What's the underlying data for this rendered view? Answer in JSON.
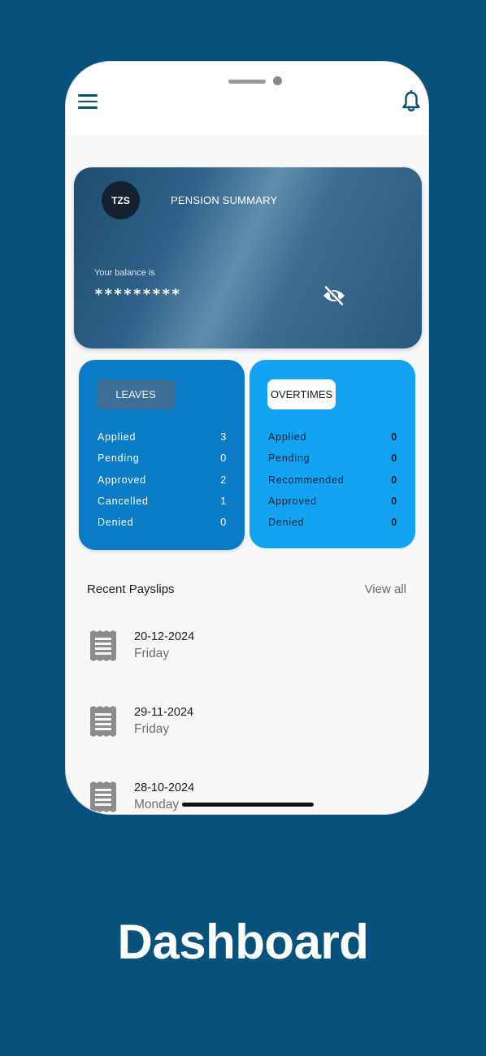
{
  "header": {
    "menu_icon": "hamburger-menu-icon",
    "notification_icon": "bell-icon"
  },
  "pension": {
    "currency": "TZS",
    "title": "PENSION SUMMARY",
    "balance_label": "Your balance is",
    "balance_masked": "*********",
    "visibility_icon": "eye-off-icon"
  },
  "leaves": {
    "label": "LEAVES",
    "rows": [
      {
        "label": "Applied",
        "value": "3"
      },
      {
        "label": "Pending",
        "value": "0"
      },
      {
        "label": "Approved",
        "value": "2"
      },
      {
        "label": "Cancelled",
        "value": "1"
      },
      {
        "label": "Denied",
        "value": "0"
      }
    ]
  },
  "overtimes": {
    "label": "OVERTIMES",
    "rows": [
      {
        "label": "Applied",
        "value": "0"
      },
      {
        "label": "Pending",
        "value": "0"
      },
      {
        "label": "Recommended",
        "value": "0"
      },
      {
        "label": "Approved",
        "value": "0"
      },
      {
        "label": "Denied",
        "value": "0"
      }
    ]
  },
  "payslips": {
    "title": "Recent Payslips",
    "view_all": "View all",
    "icon": "receipt-icon",
    "items": [
      {
        "date": "20-12-2024",
        "day": "Friday"
      },
      {
        "date": "29-11-2024",
        "day": "Friday"
      },
      {
        "date": "28-10-2024",
        "day": "Monday"
      }
    ]
  },
  "caption": "Dashboard",
  "colors": {
    "background": "#07527d",
    "leaves_card": "#0a7cc7",
    "overtimes_card": "#12a3f2"
  }
}
